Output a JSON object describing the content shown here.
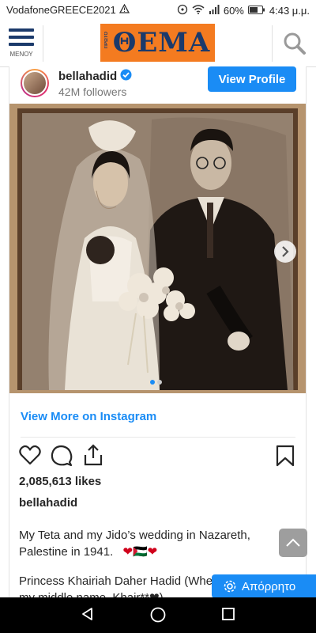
{
  "status_bar": {
    "carrier": "VodafoneGREECE2021",
    "battery": "60%",
    "time": "4:43 μ.μ."
  },
  "header": {
    "menu_label": "ΜΕΝΟΥ",
    "logo_small": "ΠΡΩΤΟ",
    "logo_text": "ΘΕΜΑ"
  },
  "instagram": {
    "username": "bellahadid",
    "followers": "42M followers",
    "view_profile": "View Profile",
    "view_more": "View More on Instagram",
    "likes": "2,085,613 likes",
    "caption_user": "bellahadid",
    "caption_1": "My Teta and my Jido’s wedding in Nazareth, Palestine in 1941.",
    "caption_1_emoji": "❤🇵🇸❤",
    "caption_2": "Princess Khairiah Daher Hadid (Whe",
    "caption_2_b": "my middle name, Khair**❤)"
  },
  "privacy_button": "Απόρρητο",
  "colors": {
    "accent": "#1a8cf5",
    "logo_bg": "#f47b20",
    "logo_text": "#1b3a6b"
  }
}
